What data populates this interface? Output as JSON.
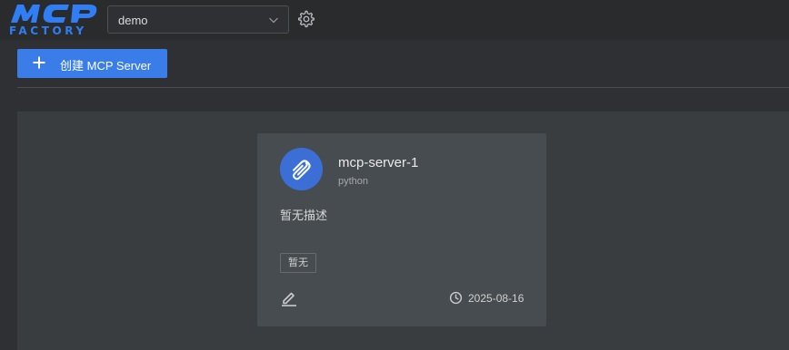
{
  "header": {
    "logo_text": "MCP",
    "logo_subtext": "FACTORY",
    "brand_color": "#2f7ef5",
    "project_select": {
      "value": "demo"
    },
    "settings_icon": "gear-icon"
  },
  "toolbar": {
    "create_label": "创建 MCP Server",
    "create_icon": "plus-icon"
  },
  "servers": [
    {
      "name": "mcp-server-1",
      "language": "python",
      "description": "暂无描述",
      "tag": "暂无",
      "date": "2025-08-16",
      "avatar_icon": "paperclip-icon",
      "edit_icon": "edit-icon",
      "date_icon": "clock-icon"
    }
  ]
}
